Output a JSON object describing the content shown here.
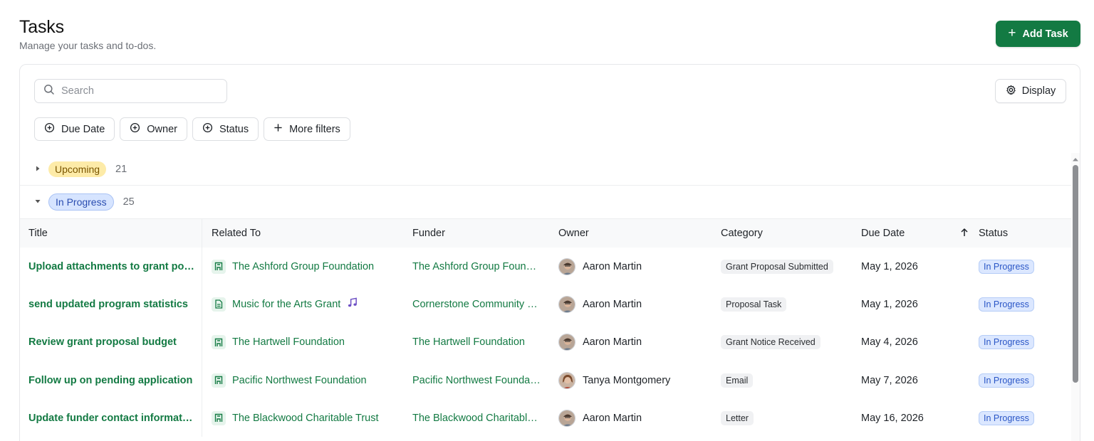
{
  "header": {
    "title": "Tasks",
    "subtitle": "Manage your tasks and to-dos.",
    "add_task_label": "Add Task"
  },
  "toolbar": {
    "search_placeholder": "Search",
    "display_label": "Display",
    "filters": [
      "Due Date",
      "Owner",
      "Status",
      "More filters"
    ]
  },
  "groups": {
    "upcoming": {
      "label": "Upcoming",
      "count": "21",
      "expanded": false
    },
    "in_progress": {
      "label": "In Progress",
      "count": "25",
      "expanded": true
    }
  },
  "table": {
    "columns": [
      "Title",
      "Related To",
      "Funder",
      "Owner",
      "Category",
      "Due Date",
      "Status"
    ],
    "sort_column": "Due Date",
    "rows": [
      {
        "title": "Upload attachments to grant portal",
        "related": "The Ashford Group Foundation",
        "related_icon": "building-icon",
        "funder": "The Ashford Group Foundation",
        "owner": "Aaron Martin",
        "category": "Grant Proposal Submitted",
        "due": "May 1, 2026",
        "status": "In Progress"
      },
      {
        "title": "send updated program statistics",
        "related": "Music for the Arts Grant",
        "related_icon": "document-icon",
        "related_extra": "music-note-icon",
        "funder": "Cornerstone Community Foundation",
        "owner": "Aaron Martin",
        "category": "Proposal Task",
        "due": "May 1, 2026",
        "status": "In Progress"
      },
      {
        "title": "Review grant proposal budget",
        "related": "The Hartwell Foundation",
        "related_icon": "building-icon",
        "funder": "The Hartwell Foundation",
        "owner": "Aaron Martin",
        "category": "Grant Notice Received",
        "due": "May 4, 2026",
        "status": "In Progress"
      },
      {
        "title": "Follow up on pending application",
        "related": "Pacific Northwest Foundation",
        "related_icon": "building-icon",
        "funder": "Pacific Northwest Foundation",
        "owner": "Tanya Montgomery",
        "category": "Email",
        "due": "May 7, 2026",
        "status": "In Progress"
      },
      {
        "title": "Update funder contact information",
        "related": "The Blackwood Charitable Trust",
        "related_icon": "building-icon",
        "funder": "The Blackwood Charitable Trust",
        "owner": "Aaron Martin",
        "category": "Letter",
        "due": "May 16, 2026",
        "status": "In Progress"
      }
    ]
  },
  "colors": {
    "accent_green": "#137a43",
    "upcoming_pill": "#fdeba8",
    "in_progress_pill": "#d6e4ff"
  }
}
